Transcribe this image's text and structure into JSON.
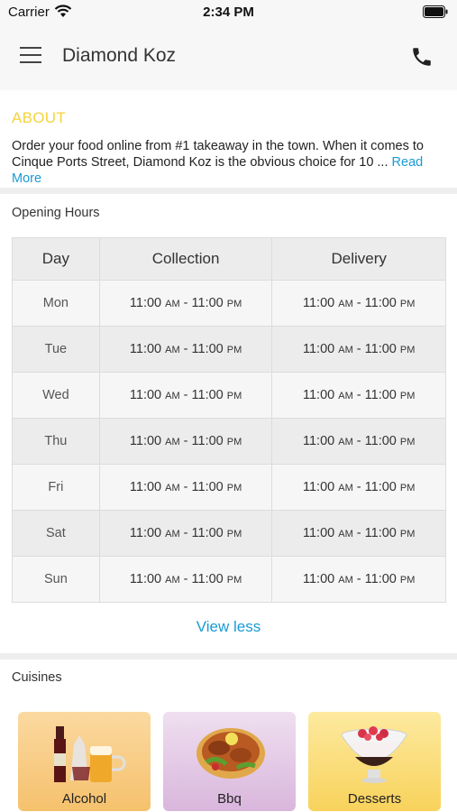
{
  "status_bar": {
    "carrier": "Carrier",
    "time": "2:34 PM"
  },
  "header": {
    "title": "Diamond Koz",
    "menu_icon": "hamburger-menu-icon",
    "phone_icon": "phone-icon"
  },
  "about": {
    "heading": "ABOUT",
    "text": "Order your food online from #1 takeaway in the town. When it comes to Cinque Ports Street, Diamond Koz is the obvious choice for 10 ...",
    "read_more": "Read More"
  },
  "opening_hours": {
    "label": "Opening Hours",
    "columns": [
      "Day",
      "Collection",
      "Delivery"
    ],
    "rows": [
      {
        "day": "Mon",
        "collection": {
          "open": "11:00",
          "open_period": "AM",
          "close": "11:00",
          "close_period": "PM"
        },
        "delivery": {
          "open": "11:00",
          "open_period": "AM",
          "close": "11:00",
          "close_period": "PM"
        }
      },
      {
        "day": "Tue",
        "collection": {
          "open": "11:00",
          "open_period": "AM",
          "close": "11:00",
          "close_period": "PM"
        },
        "delivery": {
          "open": "11:00",
          "open_period": "AM",
          "close": "11:00",
          "close_period": "PM"
        }
      },
      {
        "day": "Wed",
        "collection": {
          "open": "11:00",
          "open_period": "AM",
          "close": "11:00",
          "close_period": "PM"
        },
        "delivery": {
          "open": "11:00",
          "open_period": "AM",
          "close": "11:00",
          "close_period": "PM"
        }
      },
      {
        "day": "Thu",
        "collection": {
          "open": "11:00",
          "open_period": "AM",
          "close": "11:00",
          "close_period": "PM"
        },
        "delivery": {
          "open": "11:00",
          "open_period": "AM",
          "close": "11:00",
          "close_period": "PM"
        }
      },
      {
        "day": "Fri",
        "collection": {
          "open": "11:00",
          "open_period": "AM",
          "close": "11:00",
          "close_period": "PM"
        },
        "delivery": {
          "open": "11:00",
          "open_period": "AM",
          "close": "11:00",
          "close_period": "PM"
        }
      },
      {
        "day": "Sat",
        "collection": {
          "open": "11:00",
          "open_period": "AM",
          "close": "11:00",
          "close_period": "PM"
        },
        "delivery": {
          "open": "11:00",
          "open_period": "AM",
          "close": "11:00",
          "close_period": "PM"
        }
      },
      {
        "day": "Sun",
        "collection": {
          "open": "11:00",
          "open_period": "AM",
          "close": "11:00",
          "close_period": "PM"
        },
        "delivery": {
          "open": "11:00",
          "open_period": "AM",
          "close": "11:00",
          "close_period": "PM"
        }
      }
    ],
    "toggle_label": "View less"
  },
  "cuisines": {
    "label": "Cuisines",
    "items": [
      {
        "name": "Alcohol",
        "icon": "alcohol-bottles-icon"
      },
      {
        "name": "Bbq",
        "icon": "bbq-plate-icon"
      },
      {
        "name": "Desserts",
        "icon": "dessert-bowl-icon"
      }
    ]
  },
  "colors": {
    "accent_link": "#1a9ad6",
    "about_heading": "#f5d33a"
  }
}
